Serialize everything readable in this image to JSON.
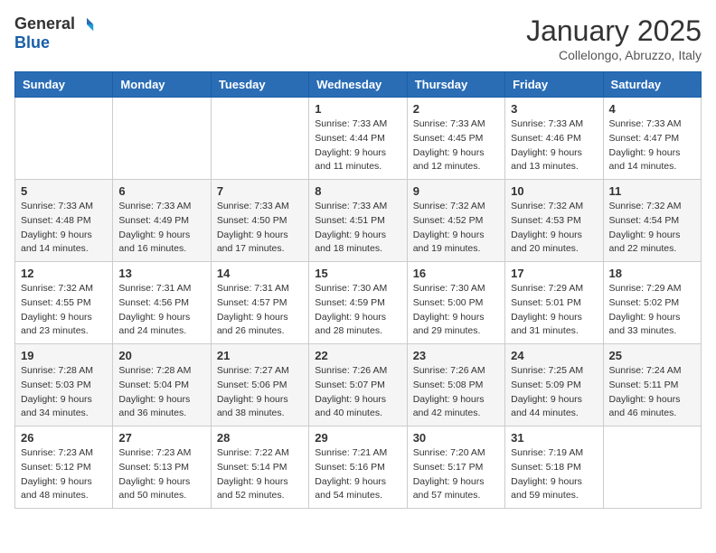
{
  "header": {
    "logo_general": "General",
    "logo_blue": "Blue",
    "month_title": "January 2025",
    "subtitle": "Collelongo, Abruzzo, Italy"
  },
  "weekdays": [
    "Sunday",
    "Monday",
    "Tuesday",
    "Wednesday",
    "Thursday",
    "Friday",
    "Saturday"
  ],
  "weeks": [
    [
      {
        "day": null
      },
      {
        "day": null
      },
      {
        "day": null
      },
      {
        "day": "1",
        "sunrise": "7:33 AM",
        "sunset": "4:44 PM",
        "daylight": "9 hours and 11 minutes."
      },
      {
        "day": "2",
        "sunrise": "7:33 AM",
        "sunset": "4:45 PM",
        "daylight": "9 hours and 12 minutes."
      },
      {
        "day": "3",
        "sunrise": "7:33 AM",
        "sunset": "4:46 PM",
        "daylight": "9 hours and 13 minutes."
      },
      {
        "day": "4",
        "sunrise": "7:33 AM",
        "sunset": "4:47 PM",
        "daylight": "9 hours and 14 minutes."
      }
    ],
    [
      {
        "day": "5",
        "sunrise": "7:33 AM",
        "sunset": "4:48 PM",
        "daylight": "9 hours and 14 minutes."
      },
      {
        "day": "6",
        "sunrise": "7:33 AM",
        "sunset": "4:49 PM",
        "daylight": "9 hours and 16 minutes."
      },
      {
        "day": "7",
        "sunrise": "7:33 AM",
        "sunset": "4:50 PM",
        "daylight": "9 hours and 17 minutes."
      },
      {
        "day": "8",
        "sunrise": "7:33 AM",
        "sunset": "4:51 PM",
        "daylight": "9 hours and 18 minutes."
      },
      {
        "day": "9",
        "sunrise": "7:32 AM",
        "sunset": "4:52 PM",
        "daylight": "9 hours and 19 minutes."
      },
      {
        "day": "10",
        "sunrise": "7:32 AM",
        "sunset": "4:53 PM",
        "daylight": "9 hours and 20 minutes."
      },
      {
        "day": "11",
        "sunrise": "7:32 AM",
        "sunset": "4:54 PM",
        "daylight": "9 hours and 22 minutes."
      }
    ],
    [
      {
        "day": "12",
        "sunrise": "7:32 AM",
        "sunset": "4:55 PM",
        "daylight": "9 hours and 23 minutes."
      },
      {
        "day": "13",
        "sunrise": "7:31 AM",
        "sunset": "4:56 PM",
        "daylight": "9 hours and 24 minutes."
      },
      {
        "day": "14",
        "sunrise": "7:31 AM",
        "sunset": "4:57 PM",
        "daylight": "9 hours and 26 minutes."
      },
      {
        "day": "15",
        "sunrise": "7:30 AM",
        "sunset": "4:59 PM",
        "daylight": "9 hours and 28 minutes."
      },
      {
        "day": "16",
        "sunrise": "7:30 AM",
        "sunset": "5:00 PM",
        "daylight": "9 hours and 29 minutes."
      },
      {
        "day": "17",
        "sunrise": "7:29 AM",
        "sunset": "5:01 PM",
        "daylight": "9 hours and 31 minutes."
      },
      {
        "day": "18",
        "sunrise": "7:29 AM",
        "sunset": "5:02 PM",
        "daylight": "9 hours and 33 minutes."
      }
    ],
    [
      {
        "day": "19",
        "sunrise": "7:28 AM",
        "sunset": "5:03 PM",
        "daylight": "9 hours and 34 minutes."
      },
      {
        "day": "20",
        "sunrise": "7:28 AM",
        "sunset": "5:04 PM",
        "daylight": "9 hours and 36 minutes."
      },
      {
        "day": "21",
        "sunrise": "7:27 AM",
        "sunset": "5:06 PM",
        "daylight": "9 hours and 38 minutes."
      },
      {
        "day": "22",
        "sunrise": "7:26 AM",
        "sunset": "5:07 PM",
        "daylight": "9 hours and 40 minutes."
      },
      {
        "day": "23",
        "sunrise": "7:26 AM",
        "sunset": "5:08 PM",
        "daylight": "9 hours and 42 minutes."
      },
      {
        "day": "24",
        "sunrise": "7:25 AM",
        "sunset": "5:09 PM",
        "daylight": "9 hours and 44 minutes."
      },
      {
        "day": "25",
        "sunrise": "7:24 AM",
        "sunset": "5:11 PM",
        "daylight": "9 hours and 46 minutes."
      }
    ],
    [
      {
        "day": "26",
        "sunrise": "7:23 AM",
        "sunset": "5:12 PM",
        "daylight": "9 hours and 48 minutes."
      },
      {
        "day": "27",
        "sunrise": "7:23 AM",
        "sunset": "5:13 PM",
        "daylight": "9 hours and 50 minutes."
      },
      {
        "day": "28",
        "sunrise": "7:22 AM",
        "sunset": "5:14 PM",
        "daylight": "9 hours and 52 minutes."
      },
      {
        "day": "29",
        "sunrise": "7:21 AM",
        "sunset": "5:16 PM",
        "daylight": "9 hours and 54 minutes."
      },
      {
        "day": "30",
        "sunrise": "7:20 AM",
        "sunset": "5:17 PM",
        "daylight": "9 hours and 57 minutes."
      },
      {
        "day": "31",
        "sunrise": "7:19 AM",
        "sunset": "5:18 PM",
        "daylight": "9 hours and 59 minutes."
      },
      {
        "day": null
      }
    ]
  ],
  "labels": {
    "sunrise": "Sunrise:",
    "sunset": "Sunset:",
    "daylight": "Daylight hours"
  }
}
